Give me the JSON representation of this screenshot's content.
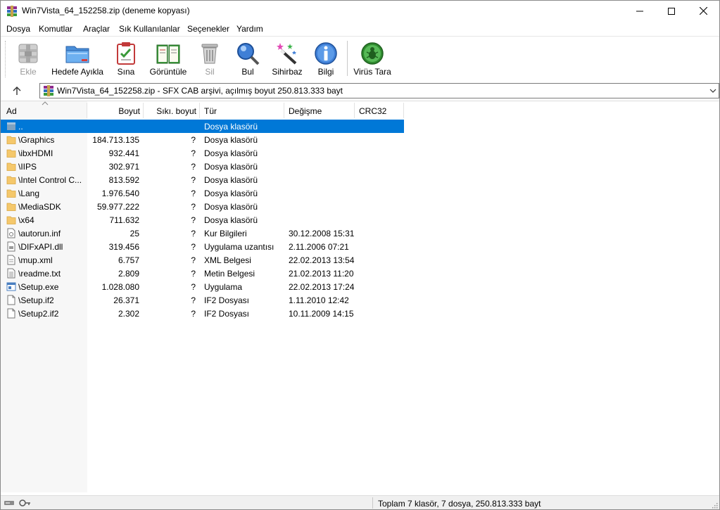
{
  "window": {
    "title": "Win7Vista_64_152258.zip (deneme kopyası)",
    "minimize_icon": "minimize-icon",
    "maximize_icon": "maximize-icon",
    "close_icon": "close-icon"
  },
  "menu": [
    "Dosya",
    "Komutlar",
    "Araçlar",
    "Sık Kullanılanlar",
    "Seçenekler",
    "Yardım"
  ],
  "toolbar": {
    "add": "Ekle",
    "extract": "Hedefe Ayıkla",
    "test": "Sına",
    "view": "Görüntüle",
    "delete": "Sil",
    "find": "Bul",
    "wizard": "Sihirbaz",
    "info": "Bilgi",
    "virus": "Virüs Tara"
  },
  "address": {
    "text": "Win7Vista_64_152258.zip - SFX CAB arşivi, açılmış boyut 250.813.333 bayt"
  },
  "columns": {
    "name": "Ad",
    "size": "Boyut",
    "packed": "Sıkı. boyut",
    "type": "Tür",
    "modified": "Değişme",
    "crc": "CRC32"
  },
  "rows": [
    {
      "name": "..",
      "size": "",
      "packed": "",
      "type": "Dosya klasörü",
      "modified": "",
      "kind": "up",
      "selected": true
    },
    {
      "name": "\\Graphics",
      "size": "184.713.135",
      "packed": "?",
      "type": "Dosya klasörü",
      "modified": "",
      "kind": "folder"
    },
    {
      "name": "\\ibxHDMI",
      "size": "932.441",
      "packed": "?",
      "type": "Dosya klasörü",
      "modified": "",
      "kind": "folder"
    },
    {
      "name": "\\IIPS",
      "size": "302.971",
      "packed": "?",
      "type": "Dosya klasörü",
      "modified": "",
      "kind": "folder"
    },
    {
      "name": "\\Intel Control C...",
      "size": "813.592",
      "packed": "?",
      "type": "Dosya klasörü",
      "modified": "",
      "kind": "folder"
    },
    {
      "name": "\\Lang",
      "size": "1.976.540",
      "packed": "?",
      "type": "Dosya klasörü",
      "modified": "",
      "kind": "folder"
    },
    {
      "name": "\\MediaSDK",
      "size": "59.977.222",
      "packed": "?",
      "type": "Dosya klasörü",
      "modified": "",
      "kind": "folder"
    },
    {
      "name": "\\x64",
      "size": "711.632",
      "packed": "?",
      "type": "Dosya klasörü",
      "modified": "",
      "kind": "folder"
    },
    {
      "name": "\\autorun.inf",
      "size": "25",
      "packed": "?",
      "type": "Kur Bilgileri",
      "modified": "30.12.2008 15:31",
      "kind": "inf"
    },
    {
      "name": "\\DIFxAPI.dll",
      "size": "319.456",
      "packed": "?",
      "type": "Uygulama uzantısı",
      "modified": "2.11.2006 07:21",
      "kind": "dll"
    },
    {
      "name": "\\mup.xml",
      "size": "6.757",
      "packed": "?",
      "type": "XML Belgesi",
      "modified": "22.02.2013 13:54",
      "kind": "xml"
    },
    {
      "name": "\\readme.txt",
      "size": "2.809",
      "packed": "?",
      "type": "Metin Belgesi",
      "modified": "21.02.2013 11:20",
      "kind": "txt"
    },
    {
      "name": "\\Setup.exe",
      "size": "1.028.080",
      "packed": "?",
      "type": "Uygulama",
      "modified": "22.02.2013 17:24",
      "kind": "exe"
    },
    {
      "name": "\\Setup.if2",
      "size": "26.371",
      "packed": "?",
      "type": "IF2 Dosyası",
      "modified": "1.11.2010 12:42",
      "kind": "file"
    },
    {
      "name": "\\Setup2.if2",
      "size": "2.302",
      "packed": "?",
      "type": "IF2 Dosyası",
      "modified": "10.11.2009 14:15",
      "kind": "file"
    }
  ],
  "status": {
    "text": "Toplam 7 klasör, 7 dosya, 250.813.333 bayt"
  },
  "colors": {
    "selection": "#0078d7",
    "folder": "#f5c86b"
  }
}
